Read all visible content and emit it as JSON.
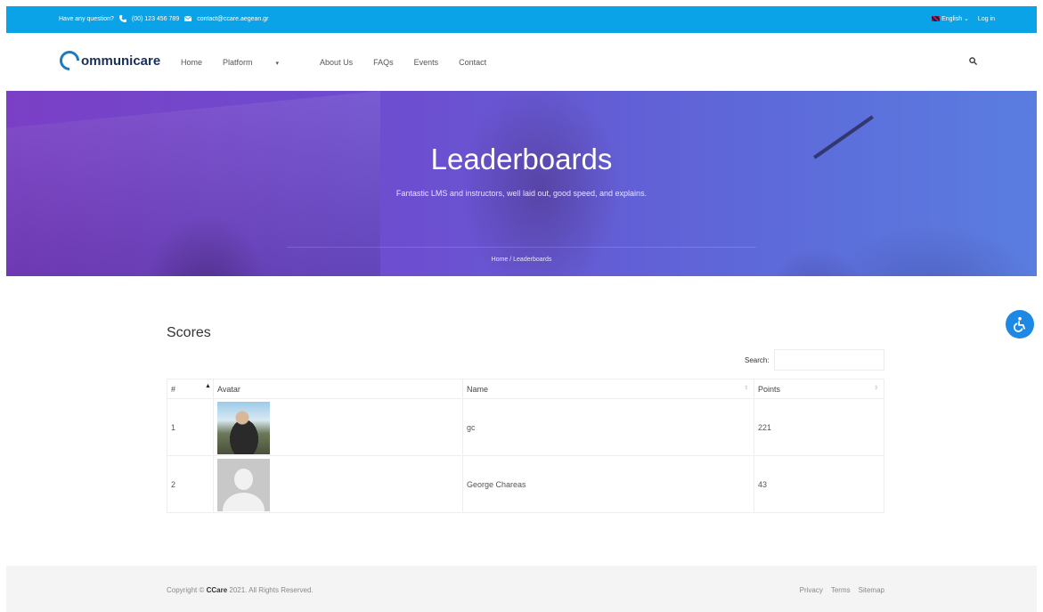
{
  "topbar": {
    "question": "Have any question?",
    "phone": "(00) 123 456 789",
    "email": "contact@ccare.aegean.gr",
    "language": "English",
    "login": "Log in"
  },
  "header": {
    "logo_text": "ommunicare",
    "nav": [
      "Home",
      "Platform",
      "About Us",
      "FAQs",
      "Events",
      "Contact"
    ]
  },
  "hero": {
    "title": "Leaderboards",
    "subtitle": "Fantastic LMS and instructors, well laid out, good speed, and explains.",
    "breadcrumb": "Home / Leaderboards"
  },
  "scores": {
    "title": "Scores",
    "search_label": "Search:",
    "search_value": "",
    "columns": [
      "#",
      "Avatar",
      "Name",
      "Points"
    ],
    "rows": [
      {
        "rank": "1",
        "avatar": "user-photo",
        "name": "gc",
        "points": "221"
      },
      {
        "rank": "2",
        "avatar": "default-avatar",
        "name": "George Chareas",
        "points": "43"
      }
    ]
  },
  "footer": {
    "copyright_prefix": "Copyright © ",
    "brand": "CCare",
    "copyright_suffix": " 2021. All Rights Reserved.",
    "links": [
      "Privacy",
      "Terms",
      "Sitemap"
    ]
  },
  "colors": {
    "topbar": "#0aa3e8",
    "accessibility": "#1e88e5",
    "logo": "#1a2e5a"
  }
}
